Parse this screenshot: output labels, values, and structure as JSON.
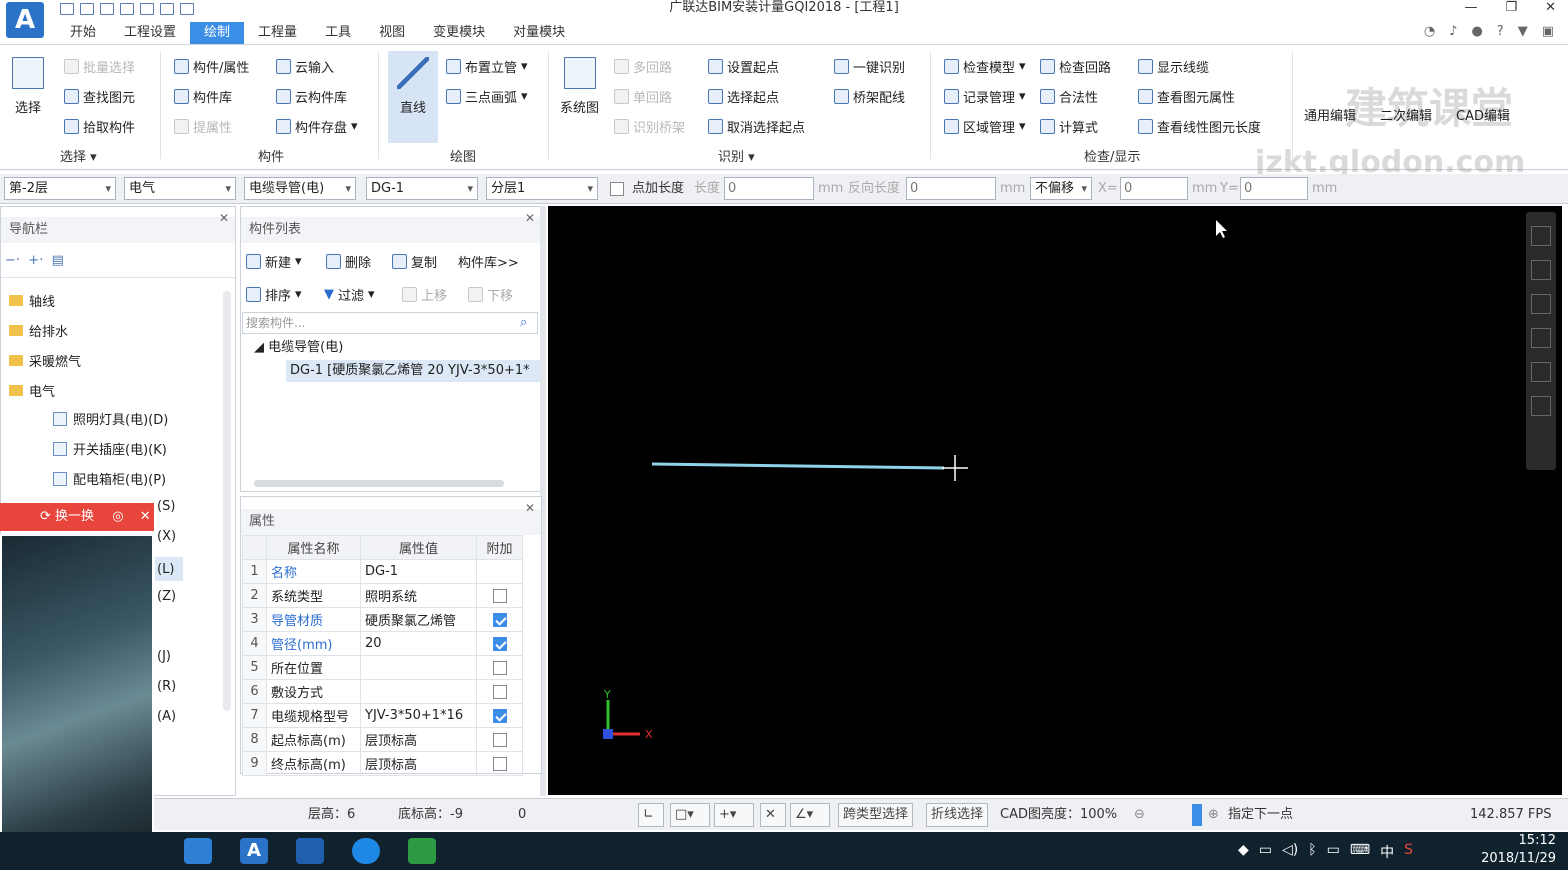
{
  "window": {
    "title": "广联达BIM安装计量GQI2018 - [工程1]",
    "logo_letter": "A"
  },
  "menu_tabs": [
    "开始",
    "工程设置",
    "绘制",
    "工程量",
    "工具",
    "视图",
    "变更模块",
    "对量模块"
  ],
  "ribbon": {
    "select": {
      "big": "选择",
      "items": [
        "批量选择",
        "查找图元",
        "拾取构件"
      ],
      "group": "选择"
    },
    "component": {
      "items": [
        "构件/属性",
        "构件库",
        "提属性",
        "云输入",
        "云构件库",
        "构件存盘"
      ],
      "group": "构件"
    },
    "draw": {
      "big": "直线",
      "items": [
        "布置立管",
        "三点画弧"
      ],
      "group": "绘图"
    },
    "identify": {
      "big": "系统图",
      "items": [
        "多回路",
        "单回路",
        "识别桥架",
        "设置起点",
        "选择起点",
        "取消选择起点",
        "一键识别",
        "桥架配线"
      ],
      "group": "识别"
    },
    "check": {
      "items": [
        "检查模型",
        "记录管理",
        "区域管理",
        "检查回路",
        "合法性",
        "计算式",
        "显示线缆",
        "查看图元属性",
        "查看线性图元长度"
      ],
      "group": "检查/显示"
    },
    "edit": {
      "items": [
        "通用编辑",
        "二次编辑",
        "CAD编辑"
      ]
    },
    "watermark": {
      "line1": "建筑课堂",
      "line2": "jzkt.glodon.com"
    }
  },
  "toolbar": {
    "floor": "第-2层",
    "discipline": "电气",
    "category": "电缆导管(电)",
    "component": "DG-1",
    "layer": "分层1",
    "point_length_label": "点加长度",
    "length_label": "长度",
    "length_value": "0",
    "unit": "mm",
    "reverse_label": "反向长度",
    "reverse_value": "0",
    "offset": "不偏移",
    "x_label": "X=",
    "x_value": "0",
    "y_label": "Y=",
    "y_value": "0"
  },
  "nav": {
    "title": "导航栏",
    "items": [
      "轴线",
      "给排水",
      "采暖燃气",
      "电气",
      "照明灯具(电)(D)",
      "开关插座(电)(K)",
      "配电箱柜(电)(P)"
    ],
    "partial": [
      "(S)",
      "(X)",
      "(L)",
      "(Z)",
      "(J)",
      "(R)",
      "(A)"
    ]
  },
  "component_list": {
    "title": "构件列表",
    "actions": [
      "新建",
      "删除",
      "复制",
      "构件库>>"
    ],
    "actions2": [
      "排序",
      "过滤",
      "上移",
      "下移"
    ],
    "search_placeholder": "搜索构件...",
    "root": "电缆导管(电)",
    "leaf": "DG-1 [硬质聚氯乙烯管 20 YJV-3*50+1*"
  },
  "properties": {
    "title": "属性",
    "headers": [
      "属性名称",
      "属性值",
      "附加"
    ],
    "rows": [
      {
        "no": "1",
        "name": "名称",
        "value": "DG-1",
        "checked": null
      },
      {
        "no": "2",
        "name": "系统类型",
        "value": "照明系统",
        "checked": false
      },
      {
        "no": "3",
        "name": "导管材质",
        "value": "硬质聚氯乙烯管",
        "checked": true
      },
      {
        "no": "4",
        "name": "管径(mm)",
        "value": "20",
        "checked": true
      },
      {
        "no": "5",
        "name": "所在位置",
        "value": "",
        "checked": false
      },
      {
        "no": "6",
        "name": "敷设方式",
        "value": "",
        "checked": false
      },
      {
        "no": "7",
        "name": "电缆规格型号",
        "value": "YJV-3*50+1*16",
        "checked": true
      },
      {
        "no": "8",
        "name": "起点标高(m)",
        "value": "层顶标高",
        "checked": false
      },
      {
        "no": "9",
        "name": "终点标高(m)",
        "value": "层顶标高",
        "checked": false
      }
    ]
  },
  "canvas": {
    "axis_x": "X",
    "axis_y": "Y"
  },
  "status": {
    "floor_height": "层高：6",
    "base_elev": "底标高：-9",
    "zero": "0",
    "cross_type": "跨类型选择",
    "polyline": "折线选择",
    "cad_brightness": "CAD图亮度：100%",
    "hint": "指定下一点",
    "fps": "142.857 FPS"
  },
  "overlay": {
    "label": "换一换"
  },
  "taskbar": {
    "time": "15:12",
    "date": "2018/11/29",
    "ime": "中"
  }
}
